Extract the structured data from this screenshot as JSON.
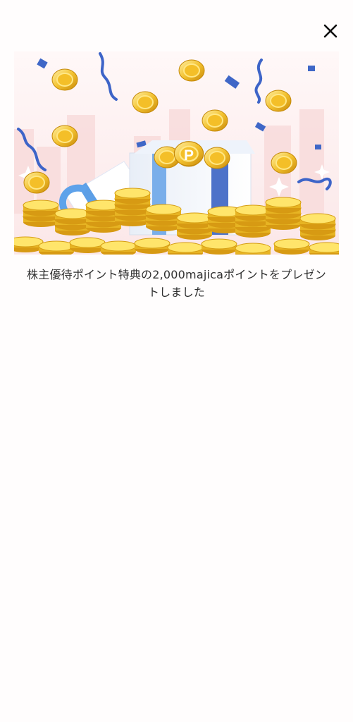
{
  "dialog": {
    "close_label": "close",
    "coin_mark": "P",
    "message": "株主優待ポイント特典の2,000majicaポイントをプレゼントしました"
  }
}
